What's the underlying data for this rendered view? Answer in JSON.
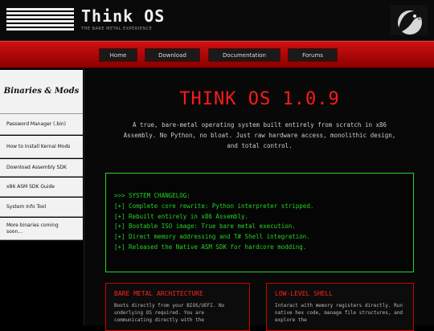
{
  "header": {
    "brand": "Think OS",
    "tagline": "THE BARE METAL EXPERIENCE"
  },
  "nav": {
    "items": [
      "Home",
      "Download",
      "Documentation",
      "Forums"
    ]
  },
  "sidebar": {
    "title": "Binaries & Mods",
    "items": [
      "Password Manager (.bin)",
      "How to Install Kernal Mods",
      "Download Assembly SDK",
      "x86 ASM SDK Guide",
      "System Info Tool",
      "More binaries coming soon..."
    ]
  },
  "main": {
    "title": "THINK OS 1.0.9",
    "description": "A true, bare-metal operating system built entirely from scratch in x86 Assembly. No Python, no bloat. Just raw hardware access, monolithic design, and total control.",
    "changelog": [
      ">>> SYSTEM CHANGELOG:",
      "[+] Complete core rewrite: Python interpreter stripped.",
      "[+] Rebuilt entirely in x86 Assembly.",
      "[+] Bootable ISO image: True bare metal execution.",
      "[+] Direct memory addressing and T# Shell integration.",
      "[+] Released the Native ASM SDK for hardcore modding."
    ],
    "cards": [
      {
        "title": "BARE METAL ARCHITECTURE",
        "text": "Boots directly from your BIOS/UEFI. No underlying OS required. You are communicating directly with the"
      },
      {
        "title": "LOW-LEVEL SHELL",
        "text": "Interact with memory registers directly. Run native hex code, manage file structures, and explore the"
      }
    ]
  },
  "colors": {
    "accent_red": "#ff1a1a",
    "terminal_green": "#23d323"
  }
}
